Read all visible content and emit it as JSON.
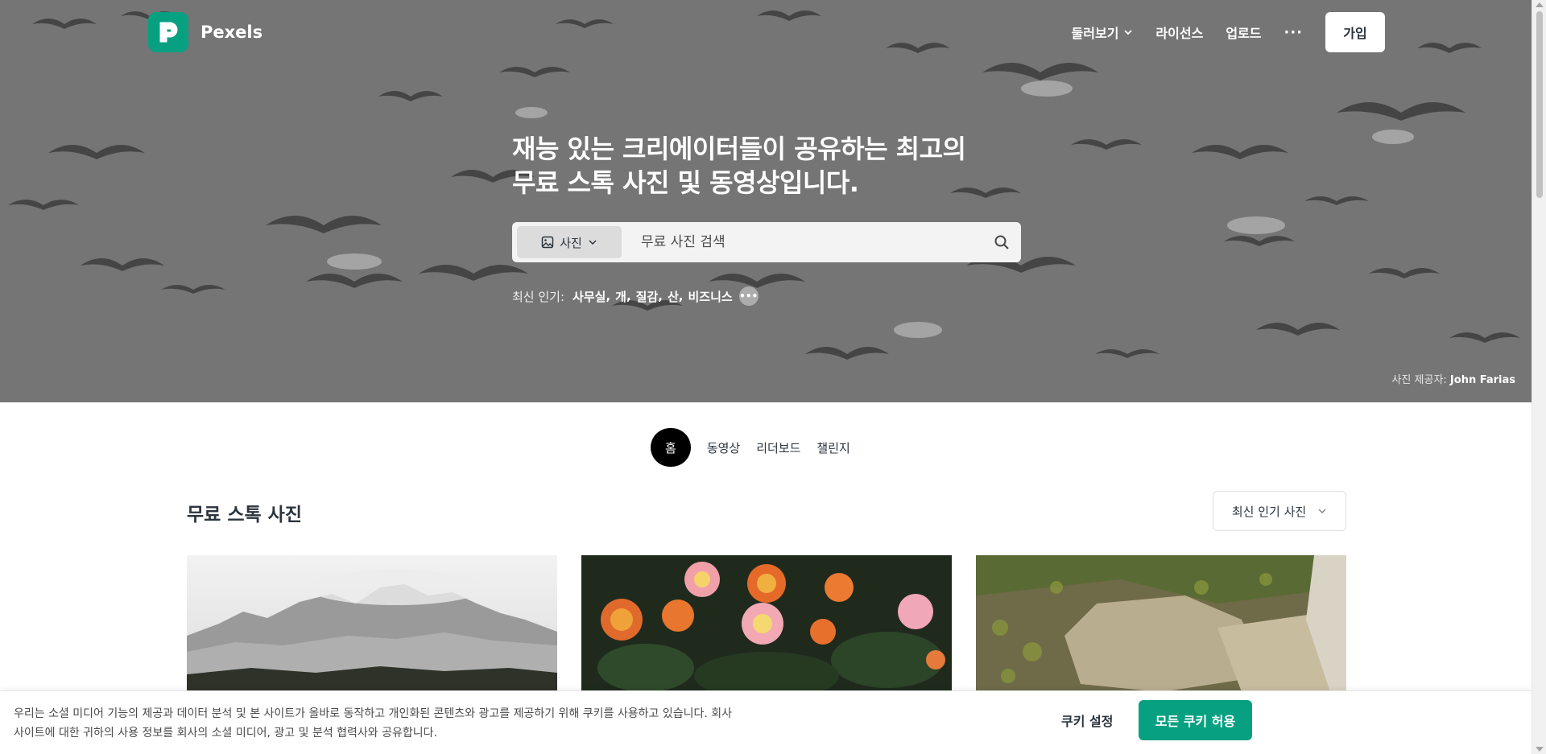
{
  "brand": {
    "name": "Pexels",
    "accent_color": "#07a081"
  },
  "nav": {
    "explore_label": "둘러보기",
    "license_label": "라이선스",
    "upload_label": "업로드",
    "more_label": "···",
    "join_label": "가입"
  },
  "hero": {
    "title_line1": "재능 있는 크리에이터들이 공유하는 최고의",
    "title_line2": "무료 스톡 사진 및 동영상입니다.",
    "search": {
      "type_label": "사진",
      "placeholder": "무료 사진 검색"
    },
    "trending": {
      "label": "최신 인기:",
      "items": [
        "사무실",
        "개",
        "질감",
        "산",
        "비즈니스"
      ],
      "more_label": "•••"
    },
    "credit_prefix": "사진 제공자:",
    "credit_name": "John Farias"
  },
  "tabs": [
    {
      "label": "홈",
      "active": true
    },
    {
      "label": "동영상",
      "active": false
    },
    {
      "label": "리더보드",
      "active": false
    },
    {
      "label": "챌린지",
      "active": false
    }
  ],
  "main": {
    "section_title": "무료 스톡 사진",
    "sort_label": "최신 인기 사진"
  },
  "cookie": {
    "text_line1": "우리는 소셜 미디어 기능의 제공과 데이터 분석 및 본 사이트가 올바로 동작하고 개인화된 콘텐츠와 광고를 제공하기 위해 쿠키를 사용하고 있습니다. 회사",
    "text_line2": "사이트에 대한 귀하의 사용 정보를 회사의 소셜 미디어, 광고 및 분석 협력사와 공유합니다.",
    "settings_label": "쿠키 설정",
    "accept_label": "모든 쿠키 허용"
  }
}
